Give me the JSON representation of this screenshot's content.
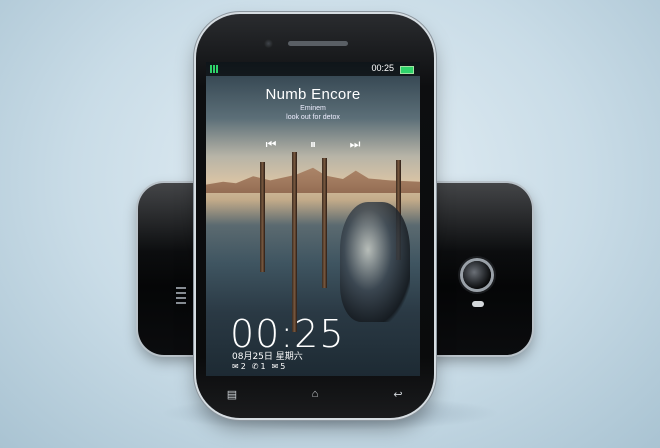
{
  "status_bar": {
    "time": "00:25",
    "signal_icon": "signal-bars-icon",
    "battery_icon": "battery-icon"
  },
  "music": {
    "title": "Numb Encore",
    "artist": "Eminem",
    "album": "look out for detox",
    "controls": {
      "previous": "⏮",
      "pause": "⏸",
      "next": "⏭"
    }
  },
  "lockscreen": {
    "clock": "00:25",
    "date": "08月25日 星期六",
    "notifications": [
      {
        "icon": "message-icon",
        "glyph": "✉",
        "count": "2"
      },
      {
        "icon": "phone-icon",
        "glyph": "✆",
        "count": "1"
      },
      {
        "icon": "mail-icon",
        "glyph": "✉",
        "count": "5"
      }
    ]
  },
  "nav_buttons": {
    "menu": "▤",
    "home": "⌂",
    "back": "↩"
  }
}
